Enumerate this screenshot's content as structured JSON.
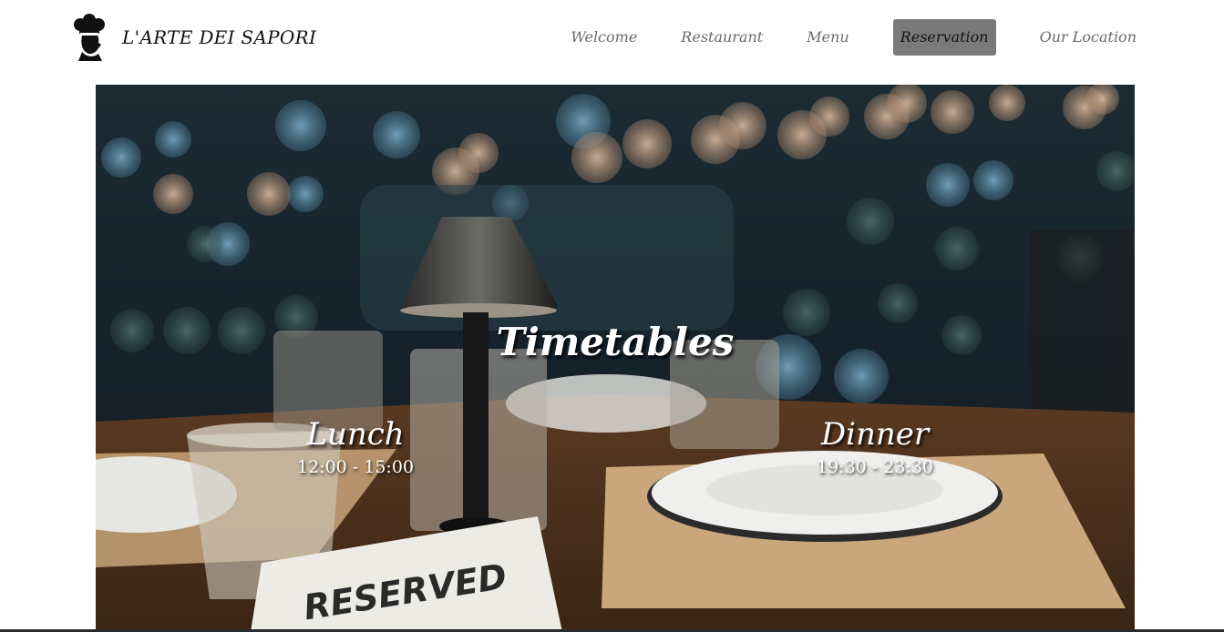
{
  "brand": {
    "name": "L'ARTE DEI SAPORI",
    "logo_icon": "chef-silhouette-icon"
  },
  "nav": {
    "items": [
      {
        "label": "Welcome",
        "active": false
      },
      {
        "label": "Restaurant",
        "active": false
      },
      {
        "label": "Menu",
        "active": false
      },
      {
        "label": "Reservation",
        "active": true
      },
      {
        "label": "Our Location",
        "active": false
      }
    ]
  },
  "hero": {
    "title": "Timetables",
    "lunch": {
      "name": "Lunch",
      "hours": "12:00 - 15:00"
    },
    "dinner": {
      "name": "Dinner",
      "hours": "19:30 - 23:30"
    },
    "image_subject": "restaurant table with reserved sign, plates, glasses and lamp"
  },
  "colors": {
    "nav_text": "#6b6b6b",
    "nav_active_bg": "#7a7a7a",
    "brand_text": "#111111",
    "hero_text": "#ffffff"
  }
}
